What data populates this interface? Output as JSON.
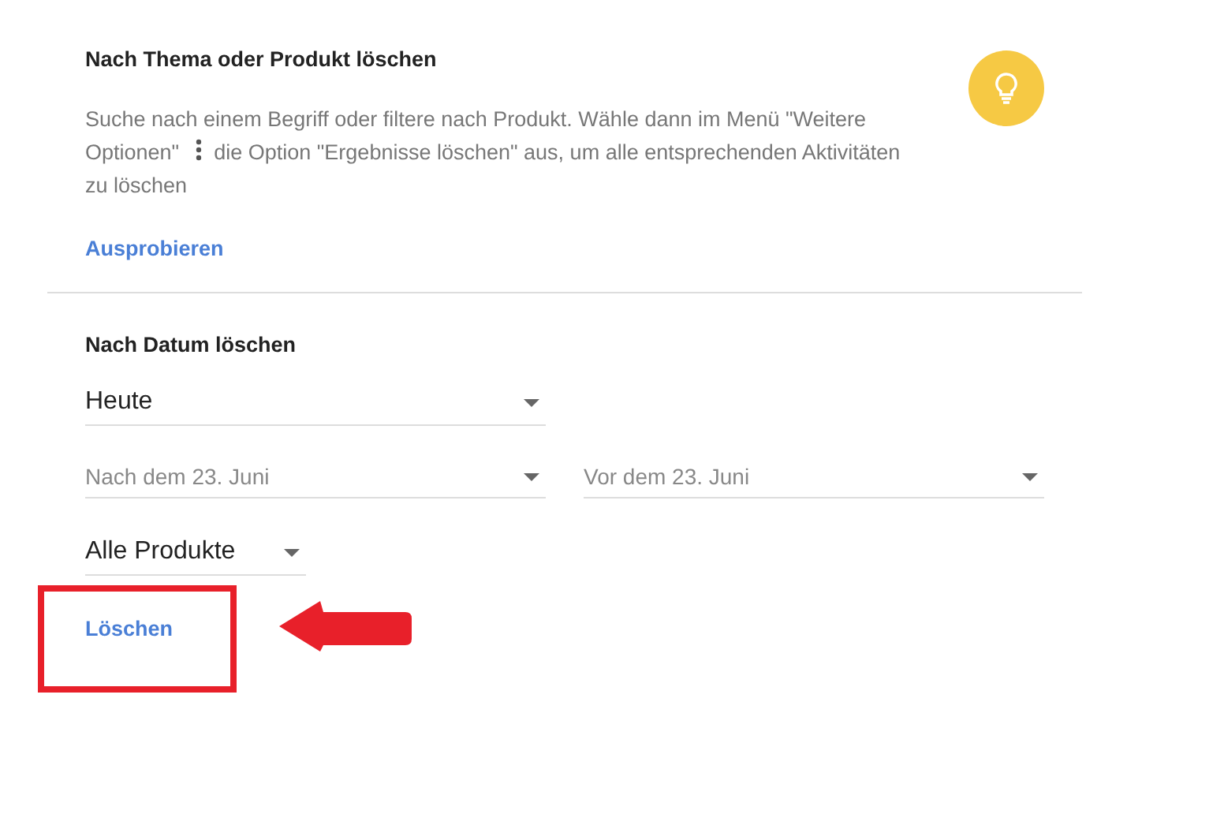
{
  "topic_section": {
    "title": "Nach Thema oder Produkt löschen",
    "description_lines": [
      [
        {
          "kind": "text",
          "text": "Suche nach einem Begriff oder filtere nach Produkt. Wähle dann im Menü \"Weitere"
        }
      ],
      [
        {
          "kind": "text",
          "text": "Optionen\""
        },
        {
          "kind": "menu_icon"
        },
        {
          "kind": "text",
          "text": "die Option \"Ergebnisse löschen\" aus, um alle entsprechenden Aktivitäten"
        }
      ],
      [
        {
          "kind": "text",
          "text": "zu löschen"
        }
      ]
    ],
    "link": "Ausprobieren"
  },
  "date_section": {
    "title": "Nach Datum löschen",
    "period": {
      "value": "Heute"
    },
    "range": [
      {
        "placeholder": "Nach dem 23. Juni"
      },
      {
        "placeholder": "Vor dem 23. Juni"
      }
    ],
    "products": {
      "value": "Alle Produkte"
    },
    "delete_button": "Löschen"
  }
}
